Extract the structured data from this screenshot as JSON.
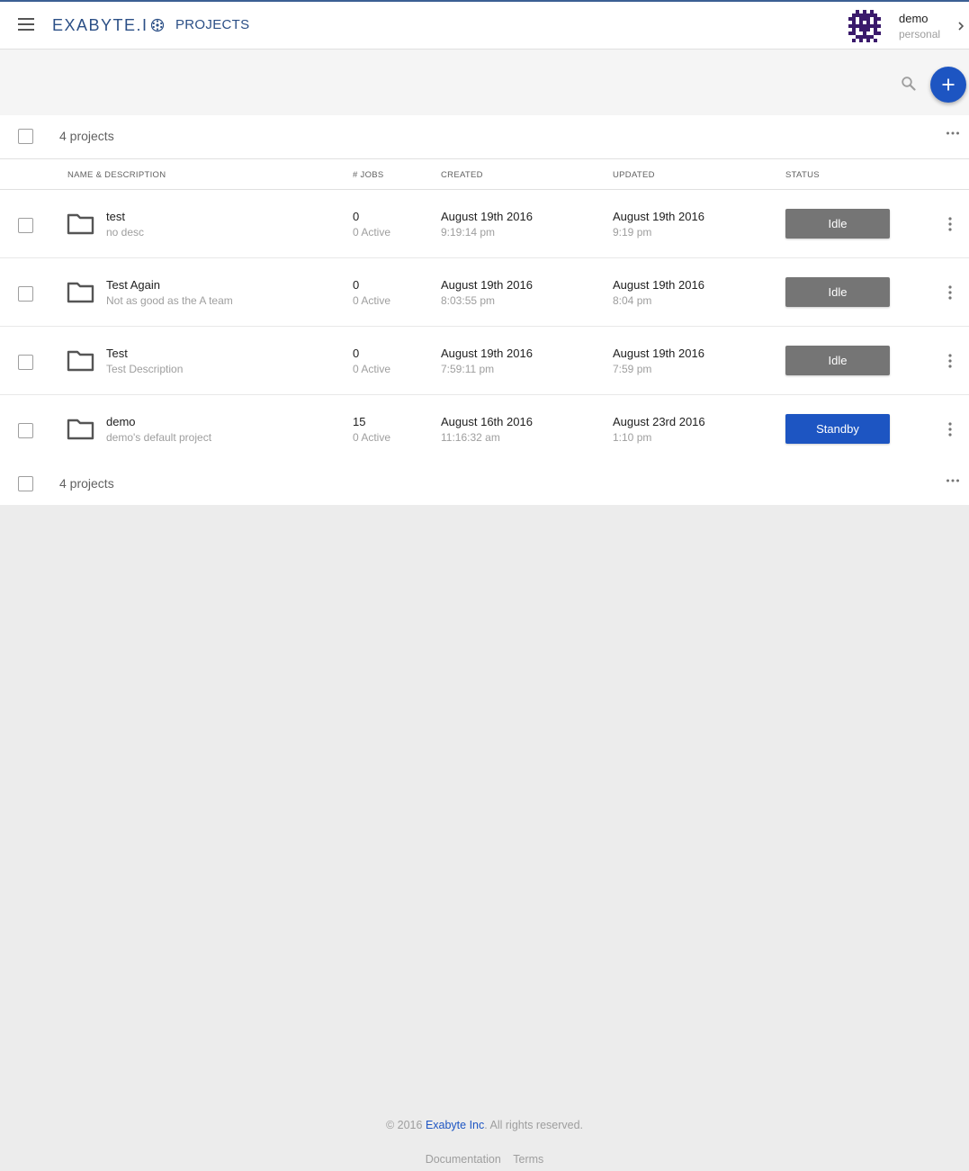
{
  "header": {
    "logo_text": "EXABYTE.I",
    "page_title": "PROJECTS",
    "user": {
      "name": "demo",
      "account": "personal"
    }
  },
  "toolbar": {
    "search_icon": "search-icon",
    "add_icon": "plus-icon"
  },
  "summary": {
    "count_label": "4 projects"
  },
  "columns": {
    "name": "NAME & DESCRIPTION",
    "jobs": "# JOBS",
    "created": "CREATED",
    "updated": "UPDATED",
    "status": "STATUS"
  },
  "projects": [
    {
      "name": "test",
      "description": "no desc",
      "jobs": "0",
      "active": "0 Active",
      "created_date": "August 19th 2016",
      "created_time": "9:19:14 pm",
      "updated_date": "August 19th 2016",
      "updated_time": "9:19 pm",
      "status": "Idle"
    },
    {
      "name": "Test Again",
      "description": "Not as good as the A team",
      "jobs": "0",
      "active": "0 Active",
      "created_date": "August 19th 2016",
      "created_time": "8:03:55 pm",
      "updated_date": "August 19th 2016",
      "updated_time": "8:04 pm",
      "status": "Idle"
    },
    {
      "name": "Test",
      "description": "Test Description",
      "jobs": "0",
      "active": "0 Active",
      "created_date": "August 19th 2016",
      "created_time": "7:59:11 pm",
      "updated_date": "August 19th 2016",
      "updated_time": "7:59 pm",
      "status": "Idle"
    },
    {
      "name": "demo",
      "description": "demo's default project",
      "jobs": "15",
      "active": "0 Active",
      "created_date": "August 16th 2016",
      "created_time": "11:16:32 am",
      "updated_date": "August 23rd 2016",
      "updated_time": "1:10 pm",
      "status": "Standby"
    }
  ],
  "footer": {
    "copyright_prefix": "© 2016 ",
    "company": "Exabyte Inc",
    "copyright_suffix": ". All rights reserved.",
    "links": [
      "Documentation",
      "Terms"
    ]
  },
  "colors": {
    "brand": "#2b4f86",
    "primary": "#1d55c2",
    "idle": "#757575",
    "standby": "#1d55c2"
  }
}
